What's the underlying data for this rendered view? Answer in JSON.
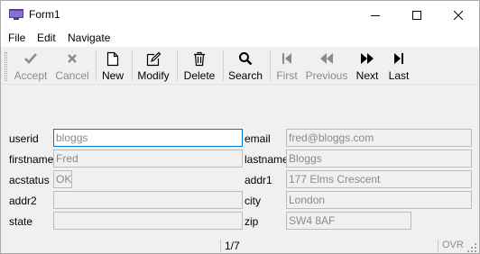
{
  "window": {
    "title": "Form1"
  },
  "menu": [
    "File",
    "Edit",
    "Navigate"
  ],
  "toolbar": {
    "accept": "Accept",
    "cancel": "Cancel",
    "new": "New",
    "modify": "Modify",
    "delete": "Delete",
    "search": "Search",
    "first": "First",
    "previous": "Previous",
    "next": "Next",
    "last": "Last"
  },
  "form": {
    "userid": {
      "label": "userid",
      "value": "bloggs"
    },
    "email": {
      "label": "email",
      "value": "fred@bloggs.com"
    },
    "firstname": {
      "label": "firstname",
      "value": "Fred"
    },
    "lastname": {
      "label": "lastname",
      "value": "Bloggs"
    },
    "acstatus": {
      "label": "acstatus",
      "value": "OK"
    },
    "addr1": {
      "label": "addr1",
      "value": "177 Elms Crescent"
    },
    "addr2": {
      "label": "addr2",
      "value": ""
    },
    "city": {
      "label": "city",
      "value": "London"
    },
    "state": {
      "label": "state",
      "value": ""
    },
    "zip": {
      "label": "zip",
      "value": "SW4 8AF"
    }
  },
  "status": {
    "position": "1/7",
    "mode": "OVR"
  },
  "colors": {
    "focus_border": "#0078d7",
    "disabled_text": "#8a8a8a"
  }
}
